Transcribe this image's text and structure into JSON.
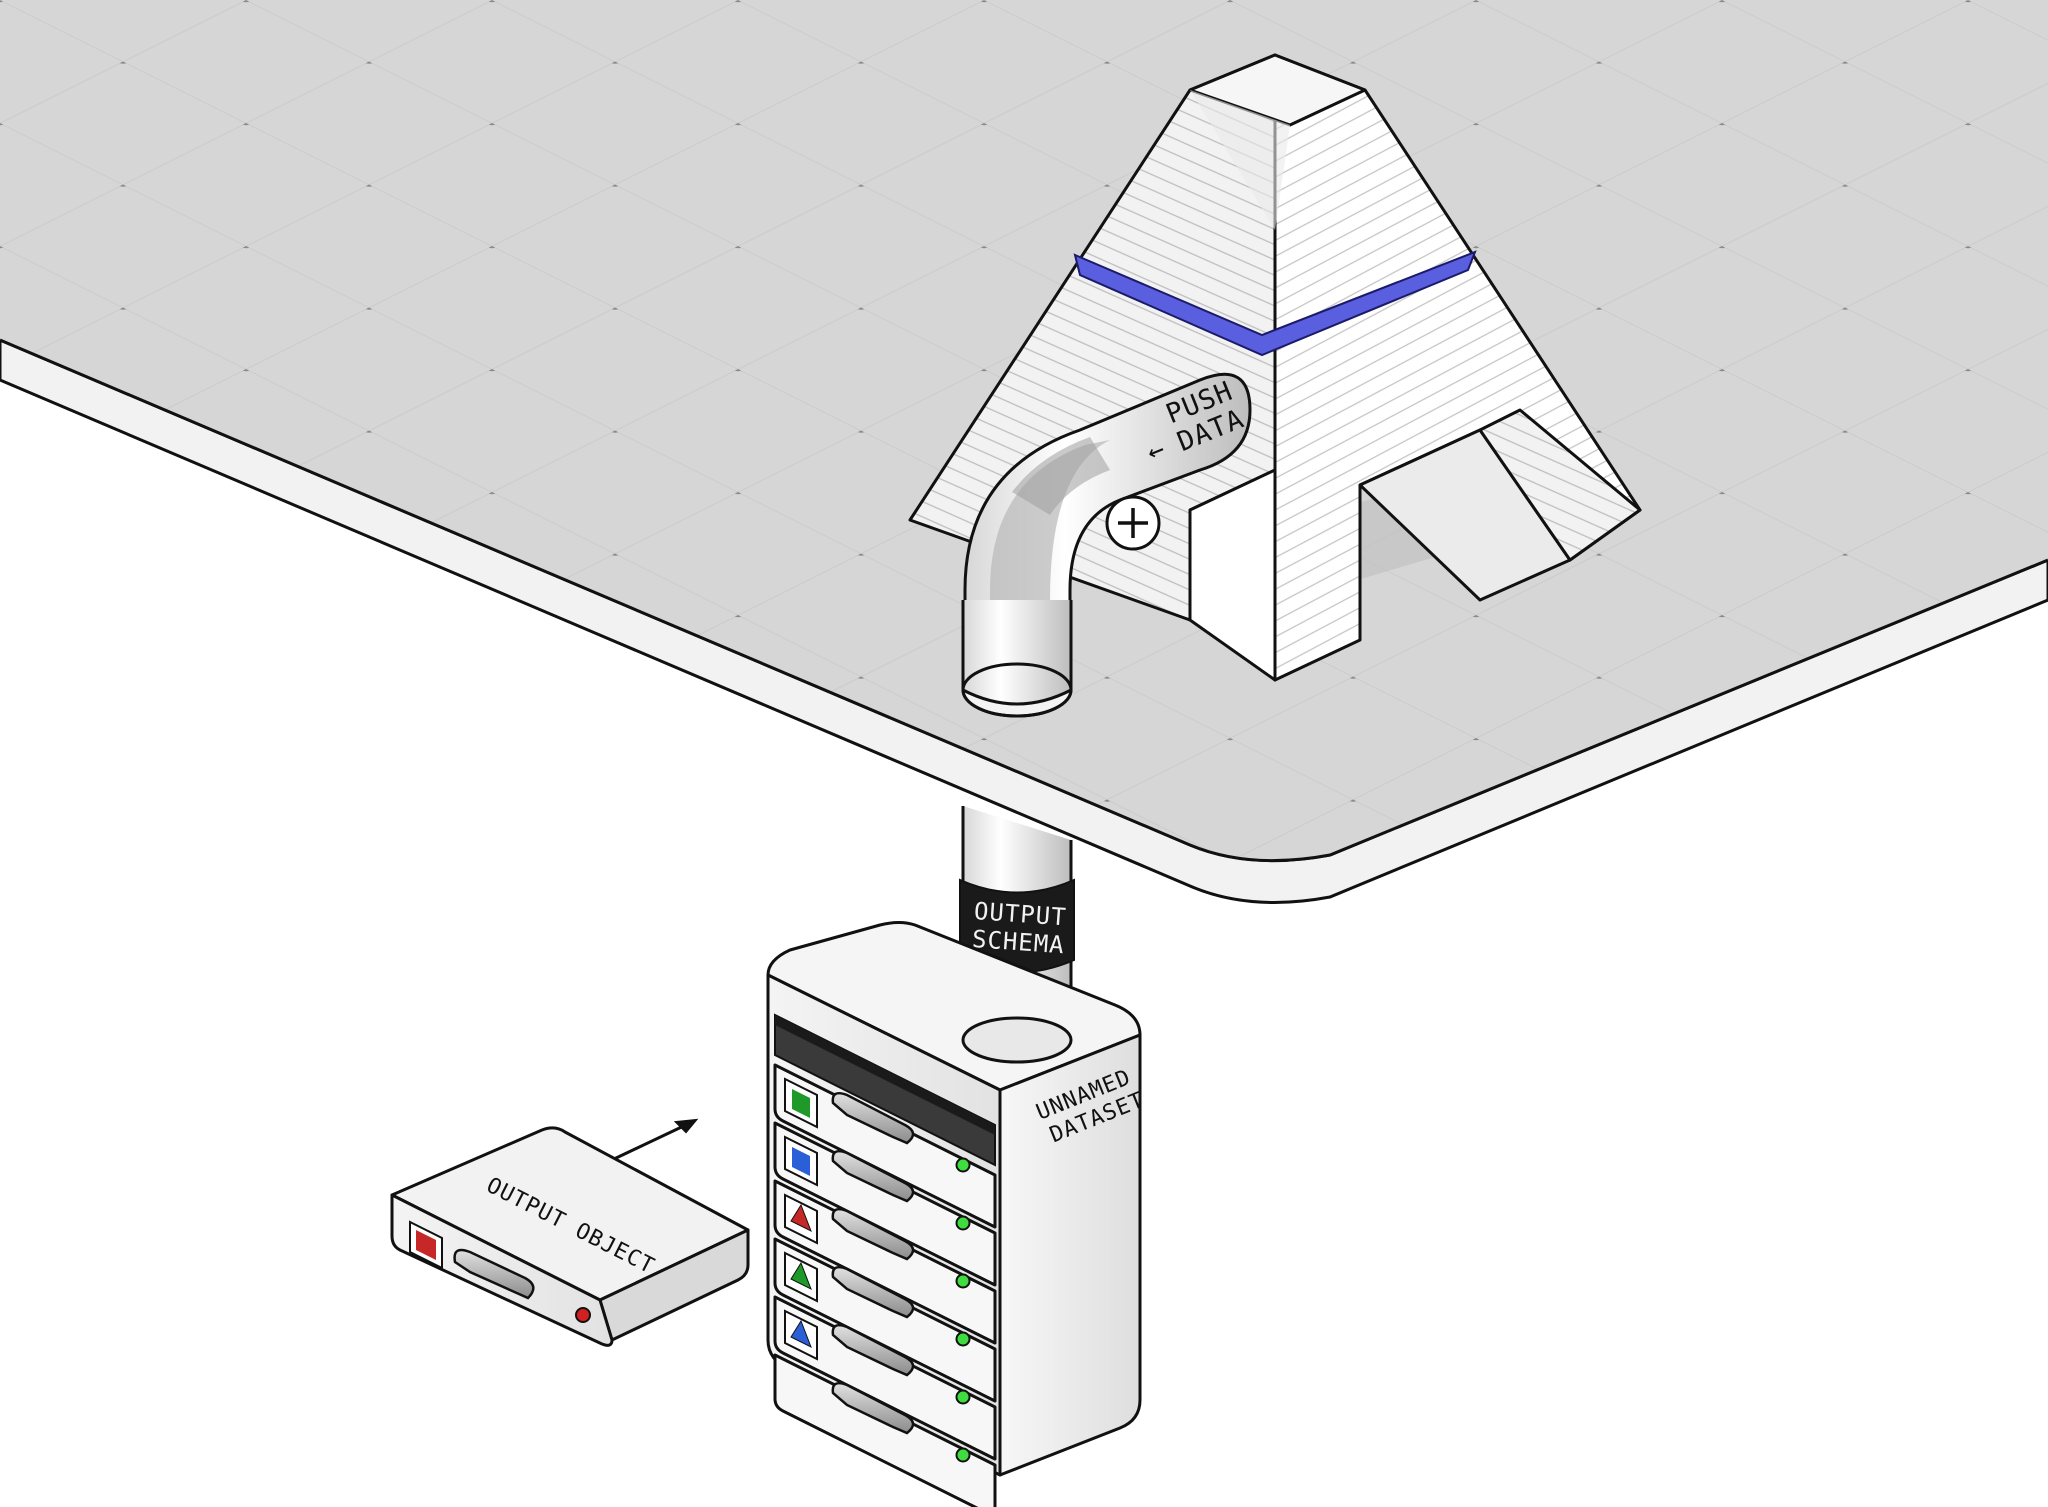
{
  "diagram": {
    "labels": {
      "push_data_line1": "PUSH",
      "push_data_line2": "DATA",
      "push_arrow": "←",
      "plus_symbol": "+",
      "output_schema_line1": "OUTPUT",
      "output_schema_line2": "SCHEMA",
      "unnamed_dataset_line1": "UNNAMED",
      "unnamed_dataset_line2": "DATASET",
      "output_object": "OUTPUT OBJECT"
    },
    "dataset_slots": [
      {
        "icon": "square",
        "color": "#1f9a2a"
      },
      {
        "icon": "square",
        "color": "#2a5fd8"
      },
      {
        "icon": "triangle",
        "color": "#c62828"
      },
      {
        "icon": "triangle",
        "color": "#1f9a2a"
      },
      {
        "icon": "triangle",
        "color": "#2a5fd8"
      }
    ],
    "output_object_icon": {
      "icon": "square",
      "color": "#c62828"
    },
    "colors": {
      "platform": "#d4d4d4",
      "platform_edge": "#f4f4f4",
      "tower_band": "#5a5fe0",
      "led_green": "#3fdc3f",
      "led_red": "#d22020",
      "schema_band": "#1a1a1a"
    }
  }
}
